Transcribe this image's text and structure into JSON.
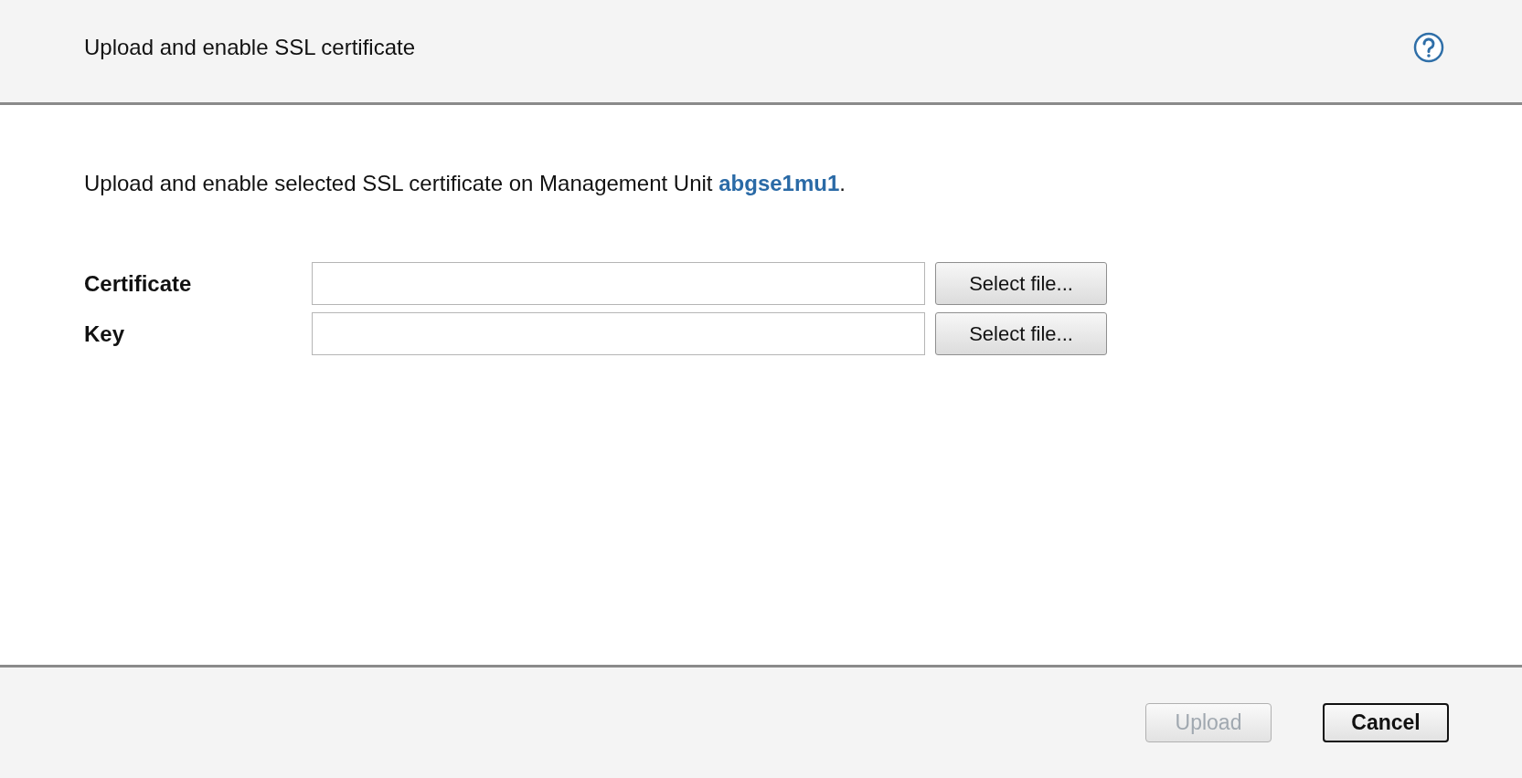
{
  "dialog": {
    "title": "Upload and enable SSL certificate"
  },
  "description": {
    "text": "Upload and enable selected SSL certificate on Management Unit ",
    "link": "abgse1mu1",
    "after": "."
  },
  "fields": [
    {
      "label": "Certificate",
      "button": "Select file..."
    },
    {
      "label": "Key",
      "button": "Select file..."
    }
  ],
  "buttons": [
    {
      "label": "Upload",
      "disabled": true,
      "default": false
    },
    {
      "label": "Cancel",
      "disabled": false,
      "default": true
    }
  ]
}
